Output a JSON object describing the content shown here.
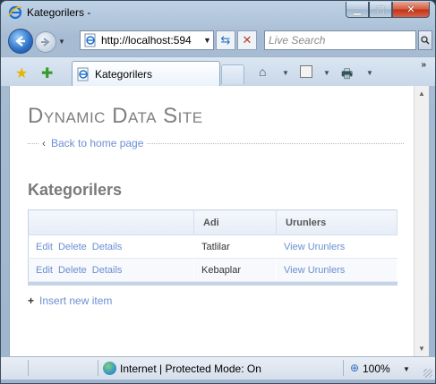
{
  "window": {
    "title": "Kategorilers -"
  },
  "navbar": {
    "url": "http://localhost:594",
    "search_placeholder": "Live Search"
  },
  "tabs": [
    {
      "label": "Kategorilers"
    }
  ],
  "page": {
    "site_title": "Dynamic Data Site",
    "back_link": "Back to home page",
    "section_title": "Kategorilers",
    "grid": {
      "columns": [
        "",
        "Adi",
        "Urunlers"
      ],
      "rows": [
        {
          "actions": [
            "Edit",
            "Delete",
            "Details"
          ],
          "adi": "Tatlilar",
          "urunlers": "View Urunlers"
        },
        {
          "actions": [
            "Edit",
            "Delete",
            "Details"
          ],
          "adi": "Kebaplar",
          "urunlers": "View Urunlers"
        }
      ]
    },
    "insert_link": "Insert new item"
  },
  "statusbar": {
    "zone": "Internet | Protected Mode: On",
    "zoom": "100%"
  }
}
